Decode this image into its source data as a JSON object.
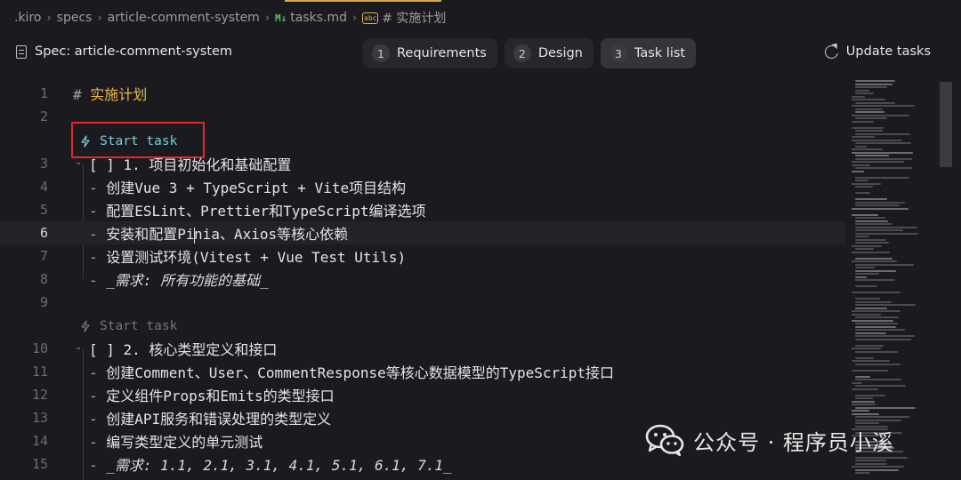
{
  "breadcrumb": {
    "items": [
      ".kiro",
      "specs",
      "article-comment-system",
      "tasks.md",
      "# 实施计划"
    ]
  },
  "toolbar": {
    "spec_title": "Spec: article-comment-system",
    "steps": [
      {
        "num": "1",
        "label": "Requirements"
      },
      {
        "num": "2",
        "label": "Design"
      },
      {
        "num": "3",
        "label": "Task list"
      }
    ],
    "active_step": "Task list",
    "update_label": "Update tasks"
  },
  "editor": {
    "current_line": "6",
    "codelens_label": "Start task",
    "lines": [
      {
        "n": "1",
        "text": "实施计划"
      },
      {
        "n": "2",
        "text": ""
      },
      {
        "n": "3",
        "text": "[ ] 1. 项目初始化和基础配置"
      },
      {
        "n": "4",
        "text": "创建Vue 3 + TypeScript + Vite项目结构"
      },
      {
        "n": "5",
        "text": "配置ESLint、Prettier和TypeScript编译选项"
      },
      {
        "n": "6a",
        "text": "安装和配置Pi"
      },
      {
        "n": "6b",
        "text": "nia、Axios等核心依赖"
      },
      {
        "n": "7",
        "text": "设置测试环境(Vitest + Vue Test Utils)"
      },
      {
        "n": "8",
        "text": "_需求: 所有功能的基础_"
      },
      {
        "n": "9",
        "text": ""
      },
      {
        "n": "10",
        "text": "[ ] 2. 核心类型定义和接口"
      },
      {
        "n": "11",
        "text": "创建Comment、User、CommentResponse等核心数据模型的TypeScript接口"
      },
      {
        "n": "12",
        "text": "定义组件Props和Emits的类型接口"
      },
      {
        "n": "13",
        "text": "创建API服务和错误处理的类型定义"
      },
      {
        "n": "14",
        "text": "编写类型定义的单元测试"
      },
      {
        "n": "15",
        "text": "_需求: 1.1, 2.1, 3.1, 4.1, 5.1, 6.1, 7.1_"
      }
    ],
    "line_numbers": [
      "1",
      "2",
      "3",
      "4",
      "5",
      "6",
      "7",
      "8",
      "9",
      "10",
      "11",
      "12",
      "13",
      "14",
      "15"
    ]
  },
  "watermark": {
    "text": "公众号 · 程序员小溪"
  },
  "colors": {
    "background": "#1b1b1f",
    "heading": "#e8b74a",
    "codelens": "#7ccdd8",
    "highlight_box": "#e5252a",
    "active_tab": "#d6a94a"
  }
}
